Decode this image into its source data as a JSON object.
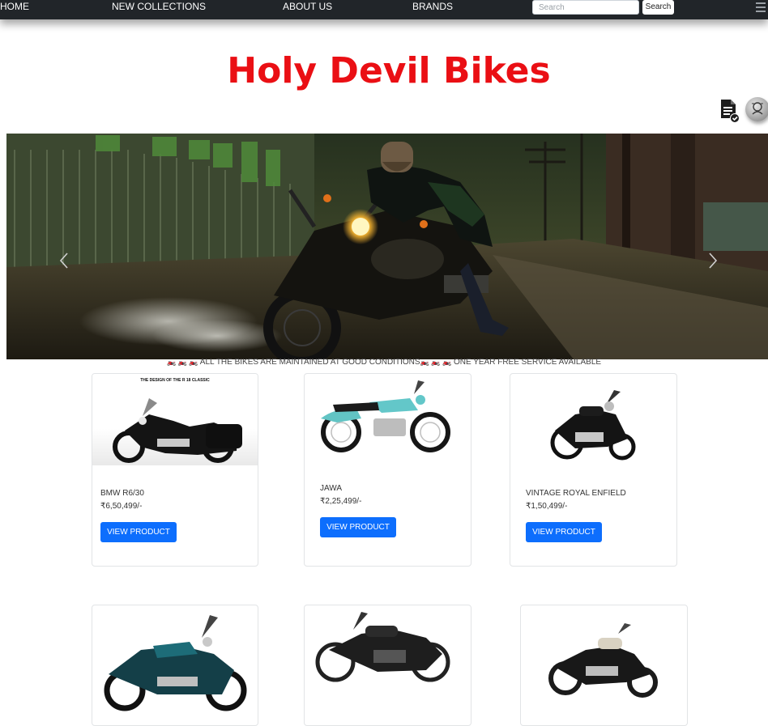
{
  "navbar": {
    "links": [
      "HOME",
      "NEW COLLECTIONS",
      "ABOUT US",
      "BRANDS"
    ],
    "search_placeholder": "Search",
    "search_button": "Search"
  },
  "site_title": "Holy Devil Bikes",
  "marquee": {
    "text1": "ALL THE BIKES ARE MAINTAINED AT GOOD CONDITIONS",
    "text2": "ONE YEAR FREE SERVICE AVAILABLE"
  },
  "products": [
    {
      "name": "BMW R6/30",
      "price": "₹6,50,499/-",
      "button": "VIEW PRODUCT",
      "image_caption": "THE DESIGN OF THE R 18 CLASSIC"
    },
    {
      "name": "JAWA",
      "price": "₹2,25,499/-",
      "button": "VIEW PRODUCT"
    },
    {
      "name": "VINTAGE ROYAL ENFIELD",
      "price": "₹1,50,499/-",
      "button": "VIEW PRODUCT"
    }
  ],
  "colors": {
    "navbar": "#212529",
    "title": "#ea0f14",
    "button": "#0d6efd"
  },
  "icons": [
    "menu-icon",
    "document-check-icon",
    "profile-avatar-icon",
    "chevron-left-icon",
    "chevron-right-icon"
  ]
}
